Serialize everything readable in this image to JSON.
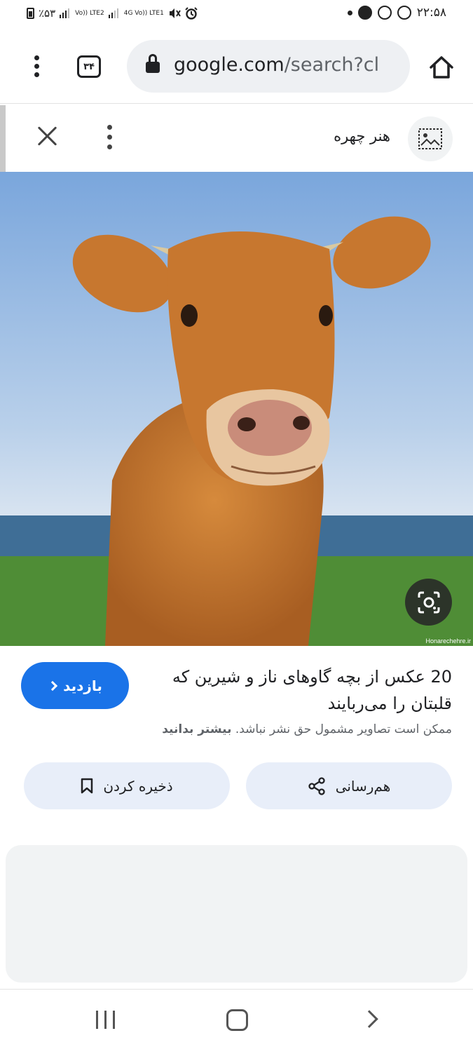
{
  "status_bar": {
    "battery": "٪۵۳",
    "network_1": "Vo)) LTE2",
    "network_2": "4G Vo)) LTE1",
    "time": "۲۲:۵۸"
  },
  "browser": {
    "tab_count": "۳۴",
    "url_domain": "google.com",
    "url_path": "/search?cl"
  },
  "viewer": {
    "source_name": "هنر چهره"
  },
  "result": {
    "title": "20 عکس از بچه گاوهای ناز و شیرین که قلبتان را می‌ربایند",
    "copyright_notice": "ممکن است تصاویر مشمول حق نشر نباشد.",
    "learn_more": "بیشتر بدانید",
    "visit_label": "بازدید",
    "save_label": "ذخیره کردن",
    "share_label": "هم‌رسانی"
  },
  "image": {
    "watermark": "Honarechehre.ir",
    "sky_color": "#8fb6e0",
    "grass_color": "#4f8d36",
    "cow_color": "#c7772f"
  },
  "colors": {
    "accent": "#1a73e8",
    "action_bg": "#e8eef9"
  }
}
